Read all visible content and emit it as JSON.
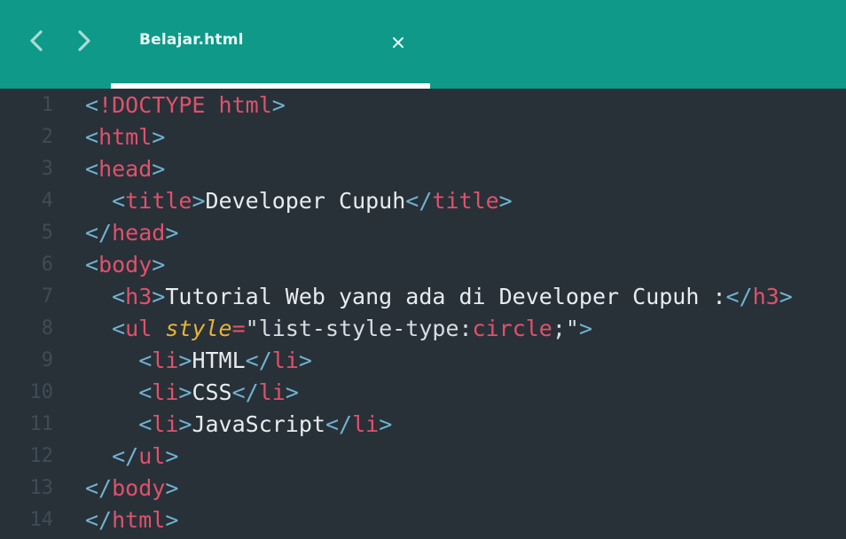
{
  "window": {
    "tab": {
      "title": "Belajar.html"
    }
  },
  "icons": {
    "back": "chevron-left-icon",
    "forward": "chevron-right-icon",
    "close": "close-icon"
  },
  "colors": {
    "topbar": "#0f9988",
    "editor_bg": "#283138",
    "tag": "#e0516c",
    "bracket": "#6fb3d2",
    "attribute": "#e5b33a",
    "text": "#e8ecef",
    "line_number": "#3f4c55"
  },
  "editor": {
    "lines": [
      {
        "n": "1",
        "tokens": [
          [
            "br",
            "<"
          ],
          [
            "tag",
            "!DOCTYPE"
          ],
          [
            "txt",
            " "
          ],
          [
            "tag",
            "html"
          ],
          [
            "br",
            ">"
          ]
        ]
      },
      {
        "n": "2",
        "tokens": [
          [
            "br",
            "<"
          ],
          [
            "tag",
            "html"
          ],
          [
            "br",
            ">"
          ]
        ]
      },
      {
        "n": "3",
        "tokens": [
          [
            "br",
            "<"
          ],
          [
            "tag",
            "head"
          ],
          [
            "br",
            ">"
          ]
        ]
      },
      {
        "n": "4",
        "tokens": [
          [
            "txt",
            "  "
          ],
          [
            "br",
            "<"
          ],
          [
            "tag",
            "title"
          ],
          [
            "br",
            ">"
          ],
          [
            "txt",
            "Developer Cupuh"
          ],
          [
            "br",
            "</"
          ],
          [
            "tag",
            "title"
          ],
          [
            "br",
            ">"
          ]
        ]
      },
      {
        "n": "5",
        "tokens": [
          [
            "br",
            "</"
          ],
          [
            "tag",
            "head"
          ],
          [
            "br",
            ">"
          ]
        ]
      },
      {
        "n": "6",
        "tokens": [
          [
            "br",
            "<"
          ],
          [
            "tag",
            "body"
          ],
          [
            "br",
            ">"
          ]
        ]
      },
      {
        "n": "7",
        "tokens": [
          [
            "txt",
            "  "
          ],
          [
            "br",
            "<"
          ],
          [
            "tag",
            "h3"
          ],
          [
            "br",
            ">"
          ],
          [
            "txt",
            "Tutorial Web yang ada di Developer Cupuh :"
          ],
          [
            "br",
            "</"
          ],
          [
            "tag",
            "h3"
          ],
          [
            "br",
            ">"
          ]
        ]
      },
      {
        "n": "8",
        "tokens": [
          [
            "txt",
            "  "
          ],
          [
            "br",
            "<"
          ],
          [
            "tag",
            "ul"
          ],
          [
            "txt",
            " "
          ],
          [
            "attr",
            "style"
          ],
          [
            "eq",
            "="
          ],
          [
            "str",
            "\"list-style-type:"
          ],
          [
            "val",
            "circle"
          ],
          [
            "str",
            ";\""
          ],
          [
            "br",
            ">"
          ]
        ]
      },
      {
        "n": "9",
        "tokens": [
          [
            "txt",
            "    "
          ],
          [
            "br",
            "<"
          ],
          [
            "tag",
            "li"
          ],
          [
            "br",
            ">"
          ],
          [
            "txt",
            "HTML"
          ],
          [
            "br",
            "</"
          ],
          [
            "tag",
            "li"
          ],
          [
            "br",
            ">"
          ]
        ]
      },
      {
        "n": "10",
        "tokens": [
          [
            "txt",
            "    "
          ],
          [
            "br",
            "<"
          ],
          [
            "tag",
            "li"
          ],
          [
            "br",
            ">"
          ],
          [
            "txt",
            "CSS"
          ],
          [
            "br",
            "</"
          ],
          [
            "tag",
            "li"
          ],
          [
            "br",
            ">"
          ]
        ]
      },
      {
        "n": "11",
        "tokens": [
          [
            "txt",
            "    "
          ],
          [
            "br",
            "<"
          ],
          [
            "tag",
            "li"
          ],
          [
            "br",
            ">"
          ],
          [
            "txt",
            "JavaScript"
          ],
          [
            "br",
            "</"
          ],
          [
            "tag",
            "li"
          ],
          [
            "br",
            ">"
          ]
        ]
      },
      {
        "n": "12",
        "tokens": [
          [
            "txt",
            "  "
          ],
          [
            "br",
            "</"
          ],
          [
            "tag",
            "ul"
          ],
          [
            "br",
            ">"
          ]
        ]
      },
      {
        "n": "13",
        "tokens": [
          [
            "br",
            "</"
          ],
          [
            "tag",
            "body"
          ],
          [
            "br",
            ">"
          ]
        ]
      },
      {
        "n": "14",
        "tokens": [
          [
            "br",
            "</"
          ],
          [
            "tag",
            "html"
          ],
          [
            "br",
            ">"
          ]
        ]
      }
    ]
  }
}
